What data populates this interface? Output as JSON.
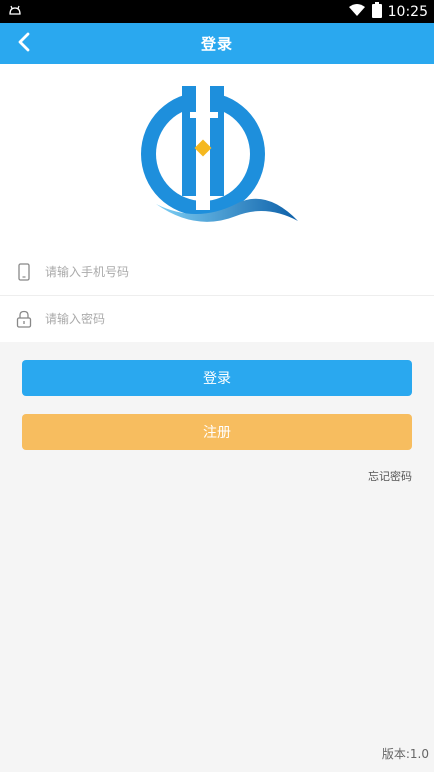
{
  "status_bar": {
    "time": "10:25",
    "icons": [
      "android-notification-icon",
      "wifi-icon",
      "battery-icon"
    ]
  },
  "header": {
    "title": "登录",
    "back_icon": "chevron-left-icon"
  },
  "logo": {
    "icon": "app-logo",
    "colors": {
      "primary": "#1e8fdc",
      "accent": "#f5b820"
    }
  },
  "form": {
    "phone": {
      "placeholder": "请输入手机号码",
      "value": "",
      "icon": "phone-icon"
    },
    "password": {
      "placeholder": "请输入密码",
      "value": "",
      "icon": "lock-icon"
    }
  },
  "buttons": {
    "login_label": "登录",
    "register_label": "注册"
  },
  "forgot_password": "忘记密码",
  "version": "版本:1.0",
  "colors": {
    "accent": "#2aa8ef",
    "register": "#f7bd5f",
    "background": "#f5f5f5"
  }
}
